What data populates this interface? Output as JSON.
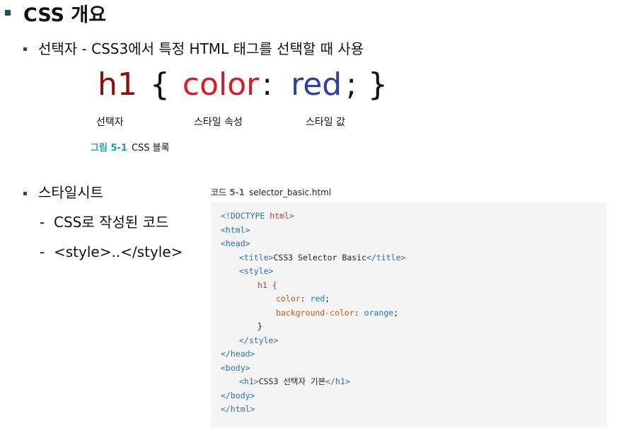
{
  "title": "CSS 개요",
  "bullet1": "선택자 - CSS3에서 특정 HTML 태그를 선택할 때 사용",
  "figure": {
    "hand": {
      "selector": "h1",
      "open_brace": "{",
      "property": "color",
      "colon": ":",
      "value": "red",
      "semicolon": ";",
      "close_brace": "}"
    },
    "labels": {
      "selector": "선택자",
      "property": "스타일 속성",
      "value": "스타일 값"
    },
    "caption_num": "그림 5-1",
    "caption_text": "CSS 블록"
  },
  "bullet2": "스타일시트",
  "sub1": "CSS로 작성된 코드",
  "sub2": "<style>..</style>",
  "code": {
    "caption_num": "코드 5-1",
    "caption_text": "selector_basic.html",
    "lines": {
      "l1_a": "<!",
      "l1_b": "DOCTYPE",
      "l1_c": " html",
      "l1_d": ">",
      "l2": "<html>",
      "l3": "<head>",
      "l4_open": "<title>",
      "l4_text": "CSS3 Selector Basic",
      "l4_close": "</title>",
      "l5": "<style>",
      "l6": "h1 {",
      "l7_prop": "color",
      "l7_sep": ": ",
      "l7_val": "red",
      "l7_end": ";",
      "l8_prop": "background-color",
      "l8_sep": ": ",
      "l8_val": "orange",
      "l8_end": ";",
      "l9": "}",
      "l10": "</style>",
      "l11": "</head>",
      "l12": "<body>",
      "l13_open": "<h1>",
      "l13_text": "CSS3 선택자 기본",
      "l13_close": "</h1>",
      "l14": "</body>",
      "l15": "</html>"
    }
  }
}
